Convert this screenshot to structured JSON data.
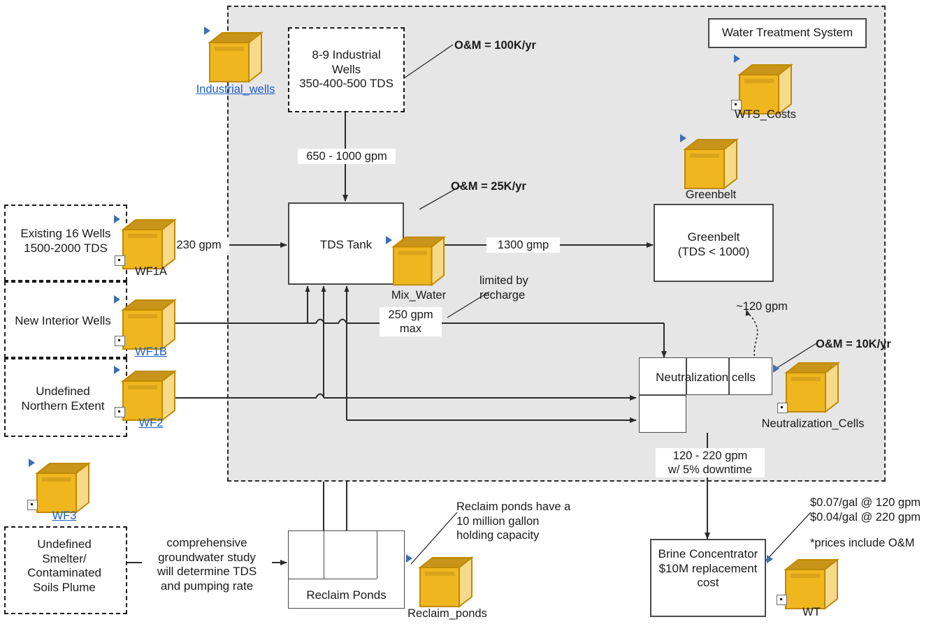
{
  "diagram": {
    "title": "Water Treatment System",
    "region_label": "Water Treatment System"
  },
  "colors": {
    "cube_front": "#f0b61e",
    "cube_top": "#c8941a",
    "cube_side": "#f7d98a",
    "cube_stroke": "#c08a00",
    "region_fill": "#e6e6e6",
    "link": "#1f5fbf",
    "marker_blue": "#3d6fb4",
    "line": "#333333"
  },
  "cubes": [
    {
      "id": "industrial_wells",
      "label": "Industrial_wells",
      "link": true,
      "square": false
    },
    {
      "id": "wts_costs",
      "label": "WTS_Costs",
      "link": false,
      "square": true
    },
    {
      "id": "greenbelt",
      "label": "Greenbelt",
      "link": false,
      "square": false
    },
    {
      "id": "wf1a",
      "label": "WF1A",
      "link": false,
      "square": true
    },
    {
      "id": "wf1b",
      "label": "WF1B",
      "link": true,
      "square": true
    },
    {
      "id": "wf2",
      "label": "WF2",
      "link": true,
      "square": true
    },
    {
      "id": "wf3",
      "label": "WF3",
      "link": true,
      "square": true
    },
    {
      "id": "mix_water",
      "label": "Mix_Water",
      "link": false,
      "square": false
    },
    {
      "id": "neutralization_cells",
      "label": "Neutralization_Cells",
      "link": false,
      "square": true
    },
    {
      "id": "reclaim_ponds",
      "label": "Reclaim_ponds",
      "link": false,
      "square": false
    },
    {
      "id": "wt",
      "label": "WT",
      "link": false,
      "square": true
    }
  ],
  "boxes": {
    "industrial_wells_note": "8-9 Industrial\nWells\n350-400-500 TDS",
    "tds_tank": "TDS Tank",
    "greenbelt": "Greenbelt\n(TDS < 1000)",
    "neutralization_cells": "Neutralization  cells",
    "reclaim_ponds": "Reclaim Ponds",
    "brine_concentrator": "Brine Concentrator\n$10M replacement\ncost",
    "existing_wells": "Existing 16 Wells\n1500-2000 TDS",
    "new_interior_wells": "New Interior Wells",
    "undefined_northern_extent": "Undefined\nNorthern Extent",
    "undefined_smelter": "Undefined\nSmelter/\nContaminated\nSoils Plume"
  },
  "flow_labels": {
    "industrial_to_tank": "650 - 1000 gpm",
    "wf1a_to_tank": "230 gpm",
    "tank_to_greenbelt": "1300 gmp",
    "wf1b_flow": "250 gpm\nmax",
    "neutralization_out": "120 - 220 gpm\nw/ 5% downtime",
    "evaporation": "~120 gpm",
    "groundwater_study": "comprehensive\ngroundwater study\nwill determine TDS\nand pumping rate"
  },
  "annotations": {
    "om_industrial": "O&M = 100K/yr",
    "om_tank": "O&M = 25K/yr",
    "om_neutralization": "O&M = 10K/yr",
    "limited_by_recharge": "limited by\nrecharge",
    "reclaim_capacity": "Reclaim ponds have a\n10 million gallon\nholding capacity",
    "brine_pricing": "$0.07/gal @ 120 gpm\n$0.04/gal @ 220 gpm",
    "brine_pricing_note": "*prices include O&M"
  }
}
